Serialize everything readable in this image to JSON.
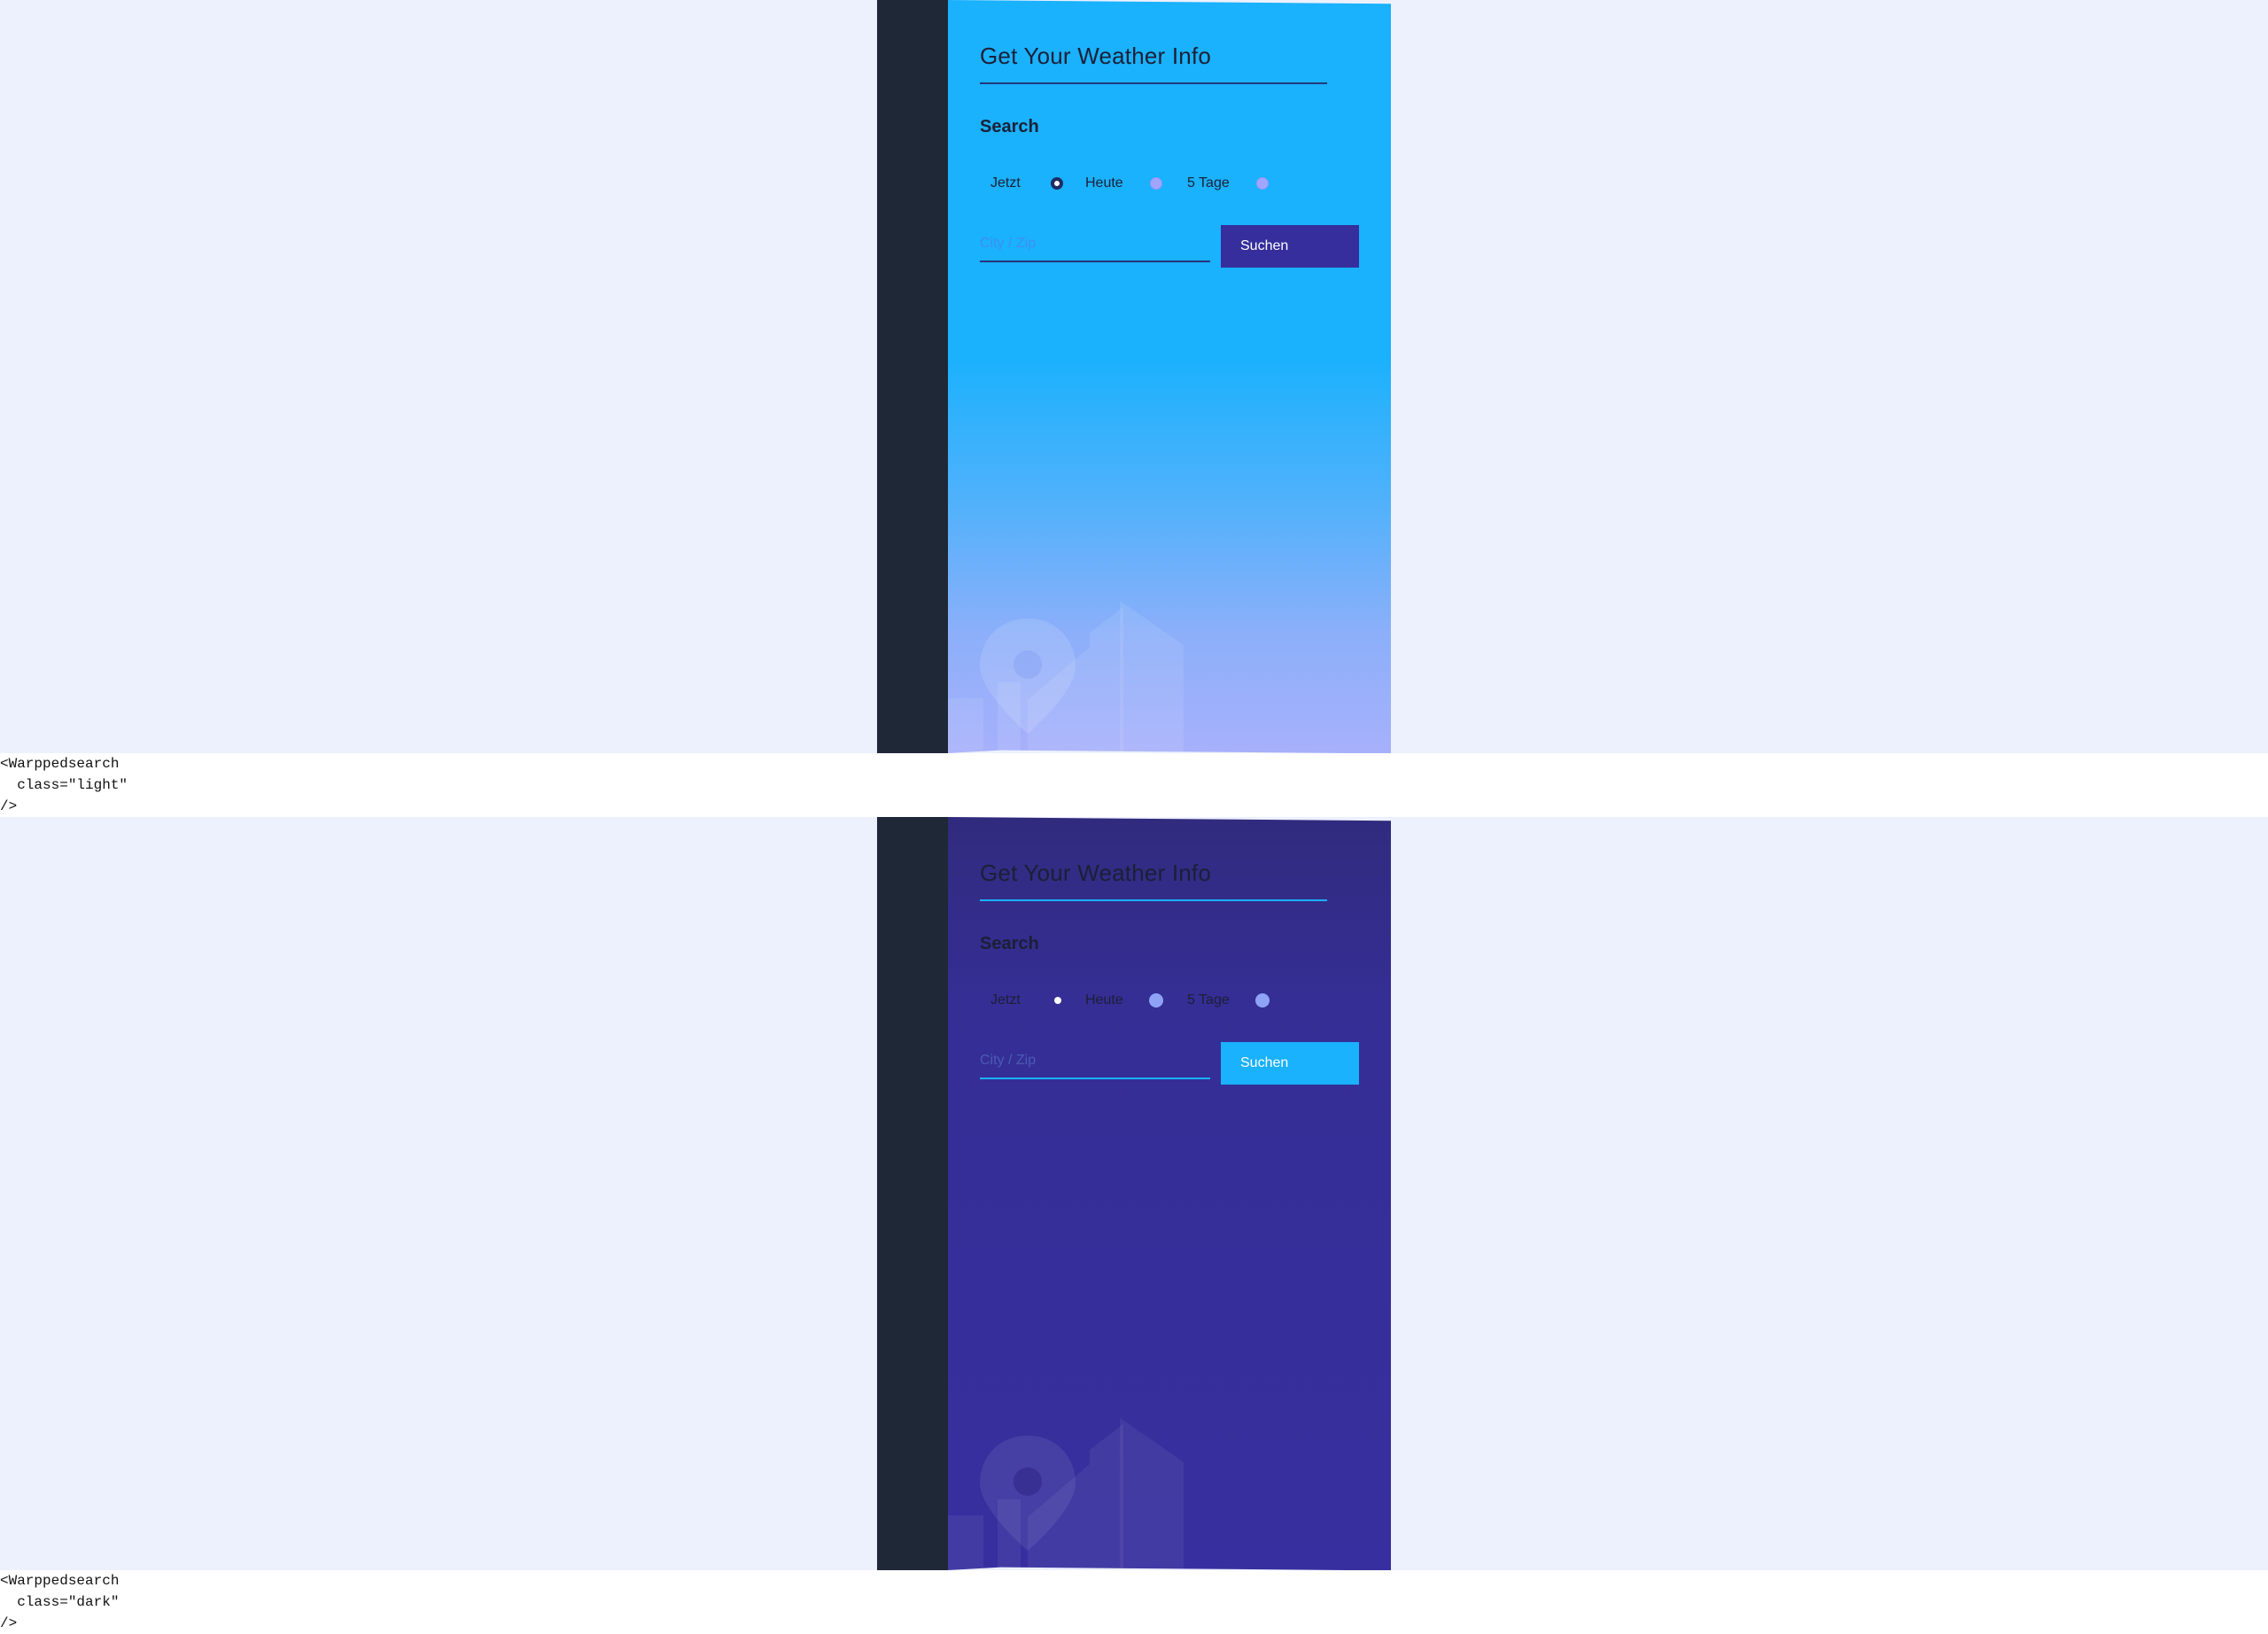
{
  "variants": [
    {
      "id": "light",
      "card": {
        "title": "Get Your Weather Info",
        "search_label": "Search",
        "radios": [
          {
            "label": "Jetzt",
            "checked": true
          },
          {
            "label": "Heute",
            "checked": false
          },
          {
            "label": "5 Tage",
            "checked": false
          }
        ],
        "input_placeholder": "City / Zip",
        "button_label": "Suchen"
      },
      "code_snippet": "<Warppedsearch\n  class=\"light\"\n/>"
    },
    {
      "id": "dark",
      "card": {
        "title": "Get Your Weather Info",
        "search_label": "Search",
        "radios": [
          {
            "label": "Jetzt",
            "checked": true
          },
          {
            "label": "Heute",
            "checked": false
          },
          {
            "label": "5 Tage",
            "checked": false
          }
        ],
        "input_placeholder": "City / Zip",
        "button_label": "Suchen"
      },
      "code_snippet": "<Warppedsearch\n  class=\"dark\"\n/>"
    }
  ],
  "colors": {
    "page_bg": "#edf1fd",
    "sidebar": "#1f2837",
    "light_card_top": "#1ab1fd",
    "light_card_bottom": "#a7b0fb",
    "light_button": "#352e9c",
    "dark_card": "#372e9d",
    "dark_button": "#1ab1fd",
    "text_dark": "#1b2035"
  },
  "icons": [
    "location-pin-icon",
    "building-icon"
  ]
}
